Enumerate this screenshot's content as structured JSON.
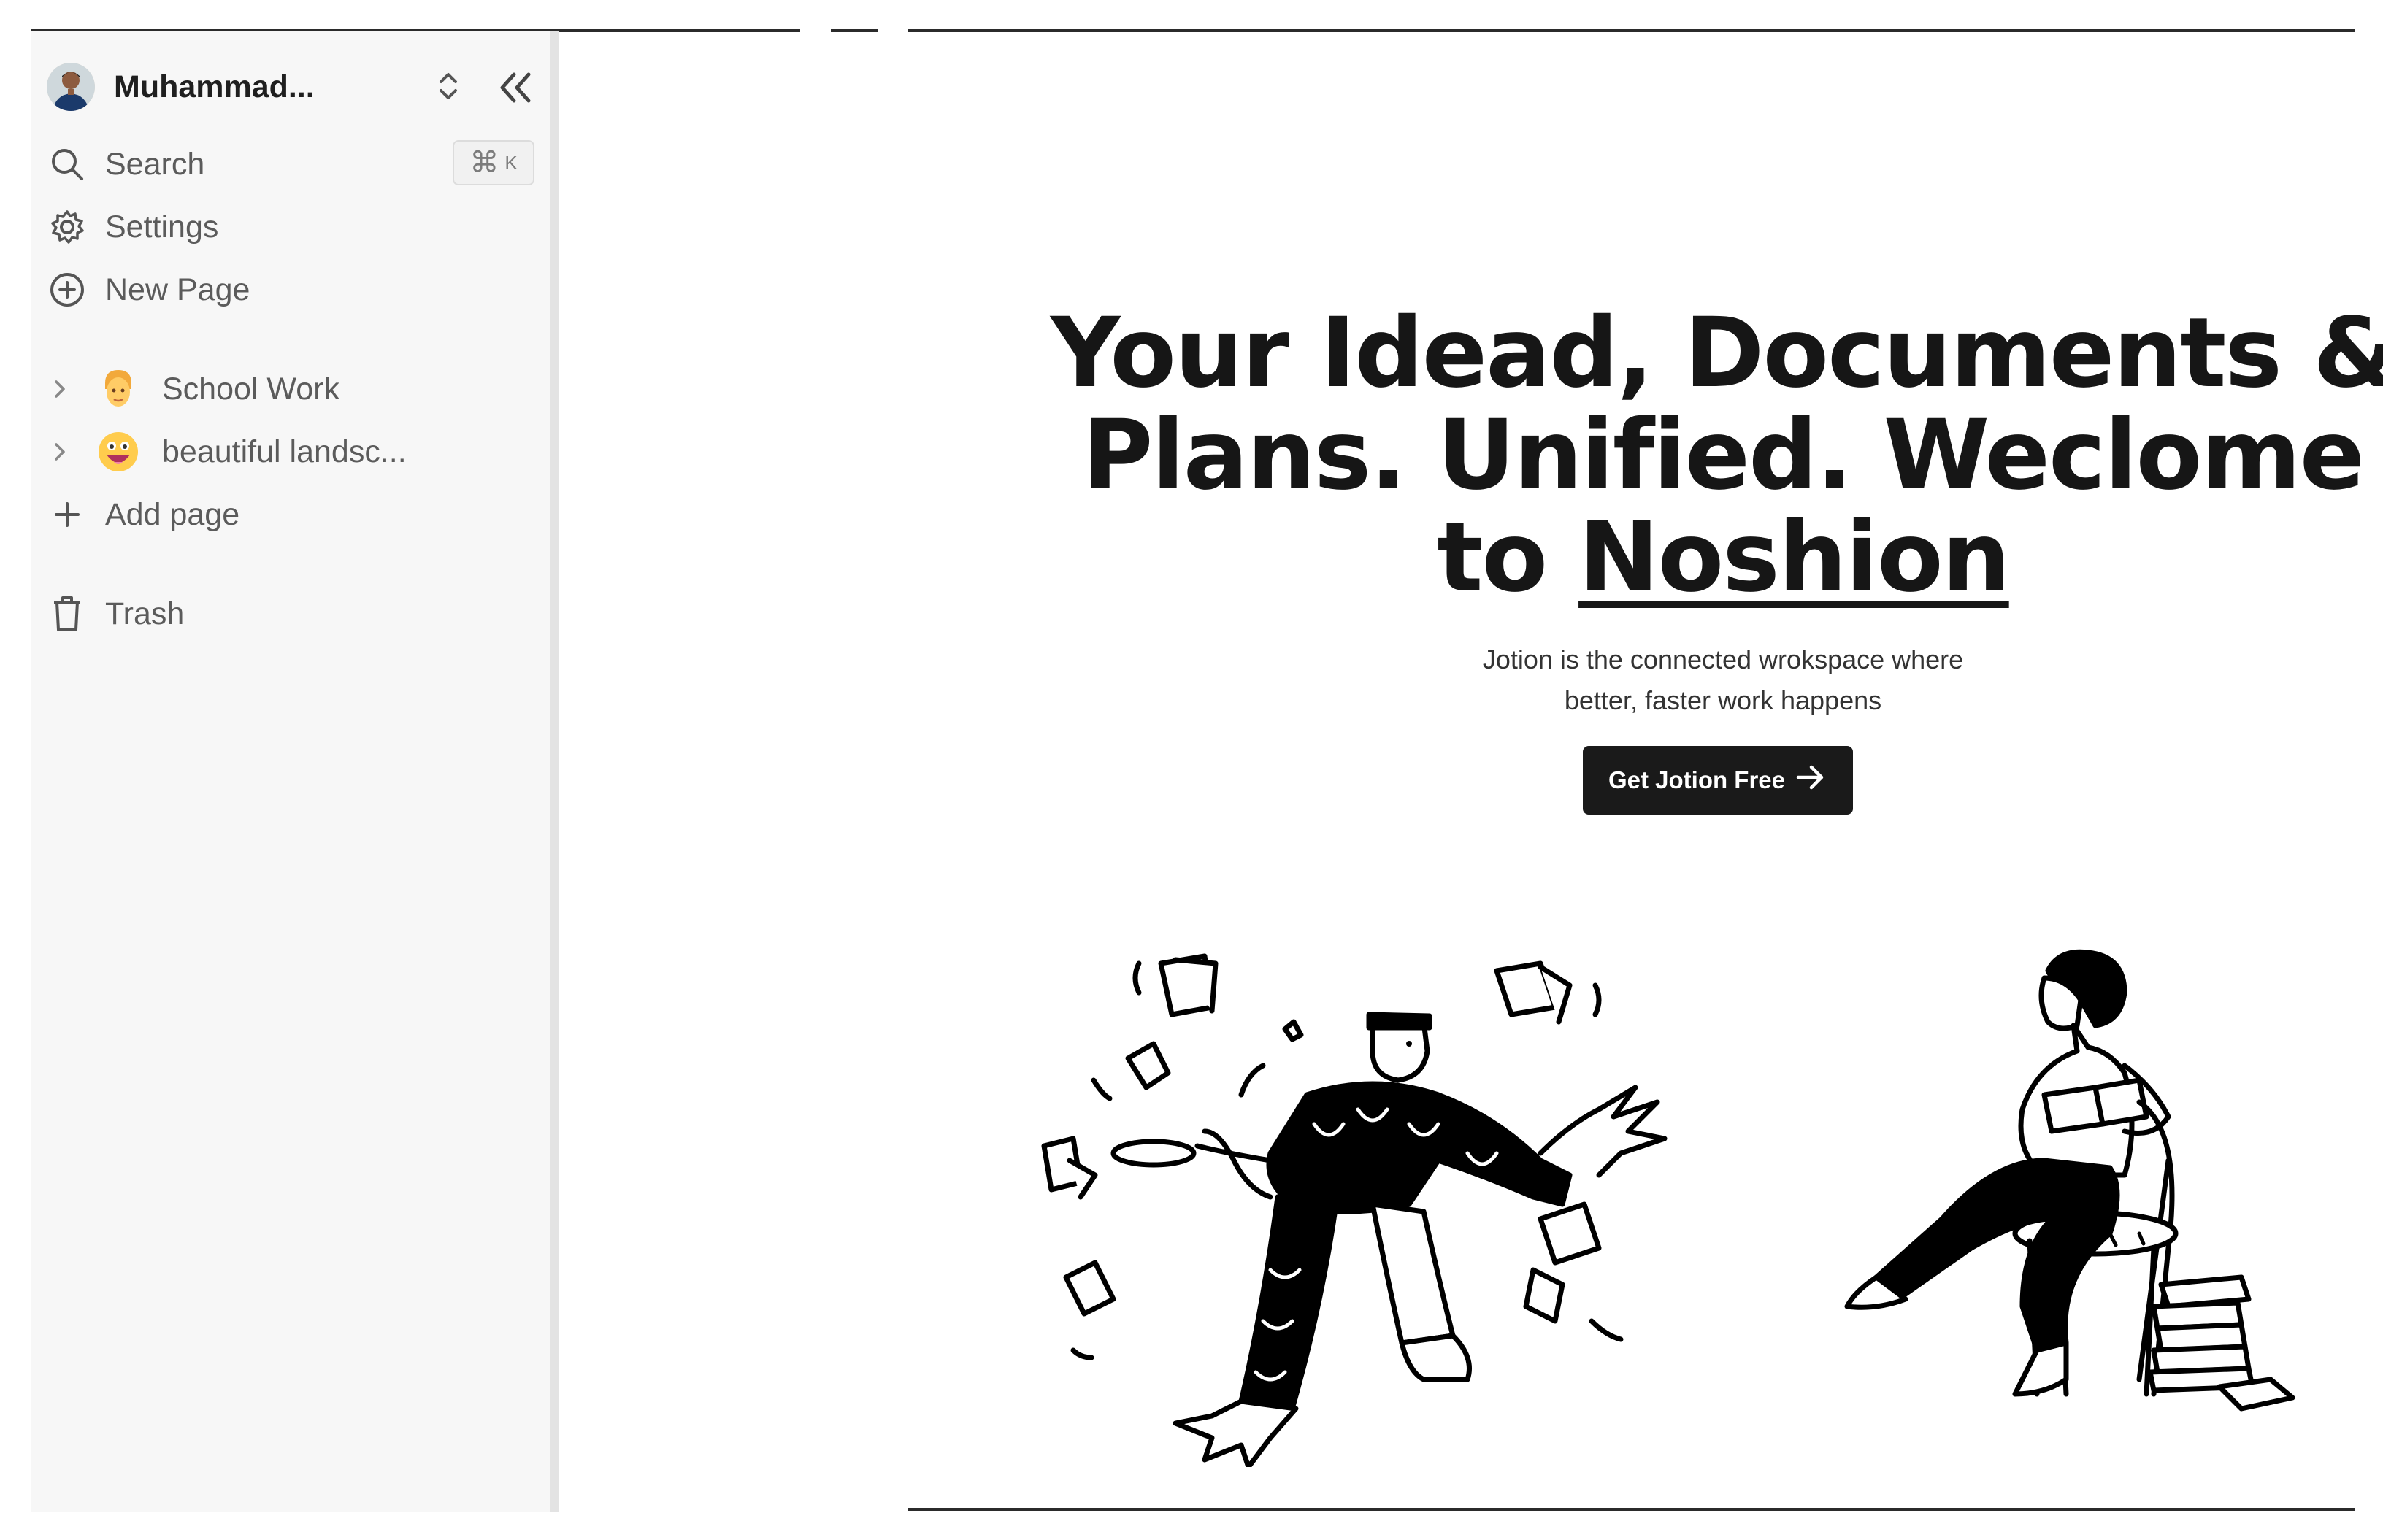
{
  "sidebar": {
    "user": {
      "name": "Muhammad...",
      "avatar_icon": "user-avatar"
    },
    "search": {
      "label": "Search",
      "shortcut_symbol": "⌘",
      "shortcut_key": "K"
    },
    "settings_label": "Settings",
    "new_page_label": "New Page",
    "documents": [
      {
        "title": "School Work",
        "icon": "person-emoji"
      },
      {
        "title": "beautiful landsc...",
        "icon": "grinning-face-emoji"
      }
    ],
    "add_page_label": "Add page",
    "trash_label": "Trash"
  },
  "hero": {
    "title_line1": "Your Idead, Documents &",
    "title_line2": "Plans. Unified. Weclome",
    "title_line3_prefix": "to ",
    "title_brand": "Noshion",
    "subtitle_line1": "Jotion is the connected wrokspace where",
    "subtitle_line2": "better, faster work happens",
    "cta_label": "Get Jotion Free",
    "illustrations": [
      "person-juggling-papers-illustration",
      "person-reading-in-chair-illustration"
    ]
  },
  "colors": {
    "sidebar_bg": "#f7f7f7",
    "cta_bg": "#1a1a1a",
    "text_dark": "#161616",
    "text_muted": "#5b5b5b"
  }
}
